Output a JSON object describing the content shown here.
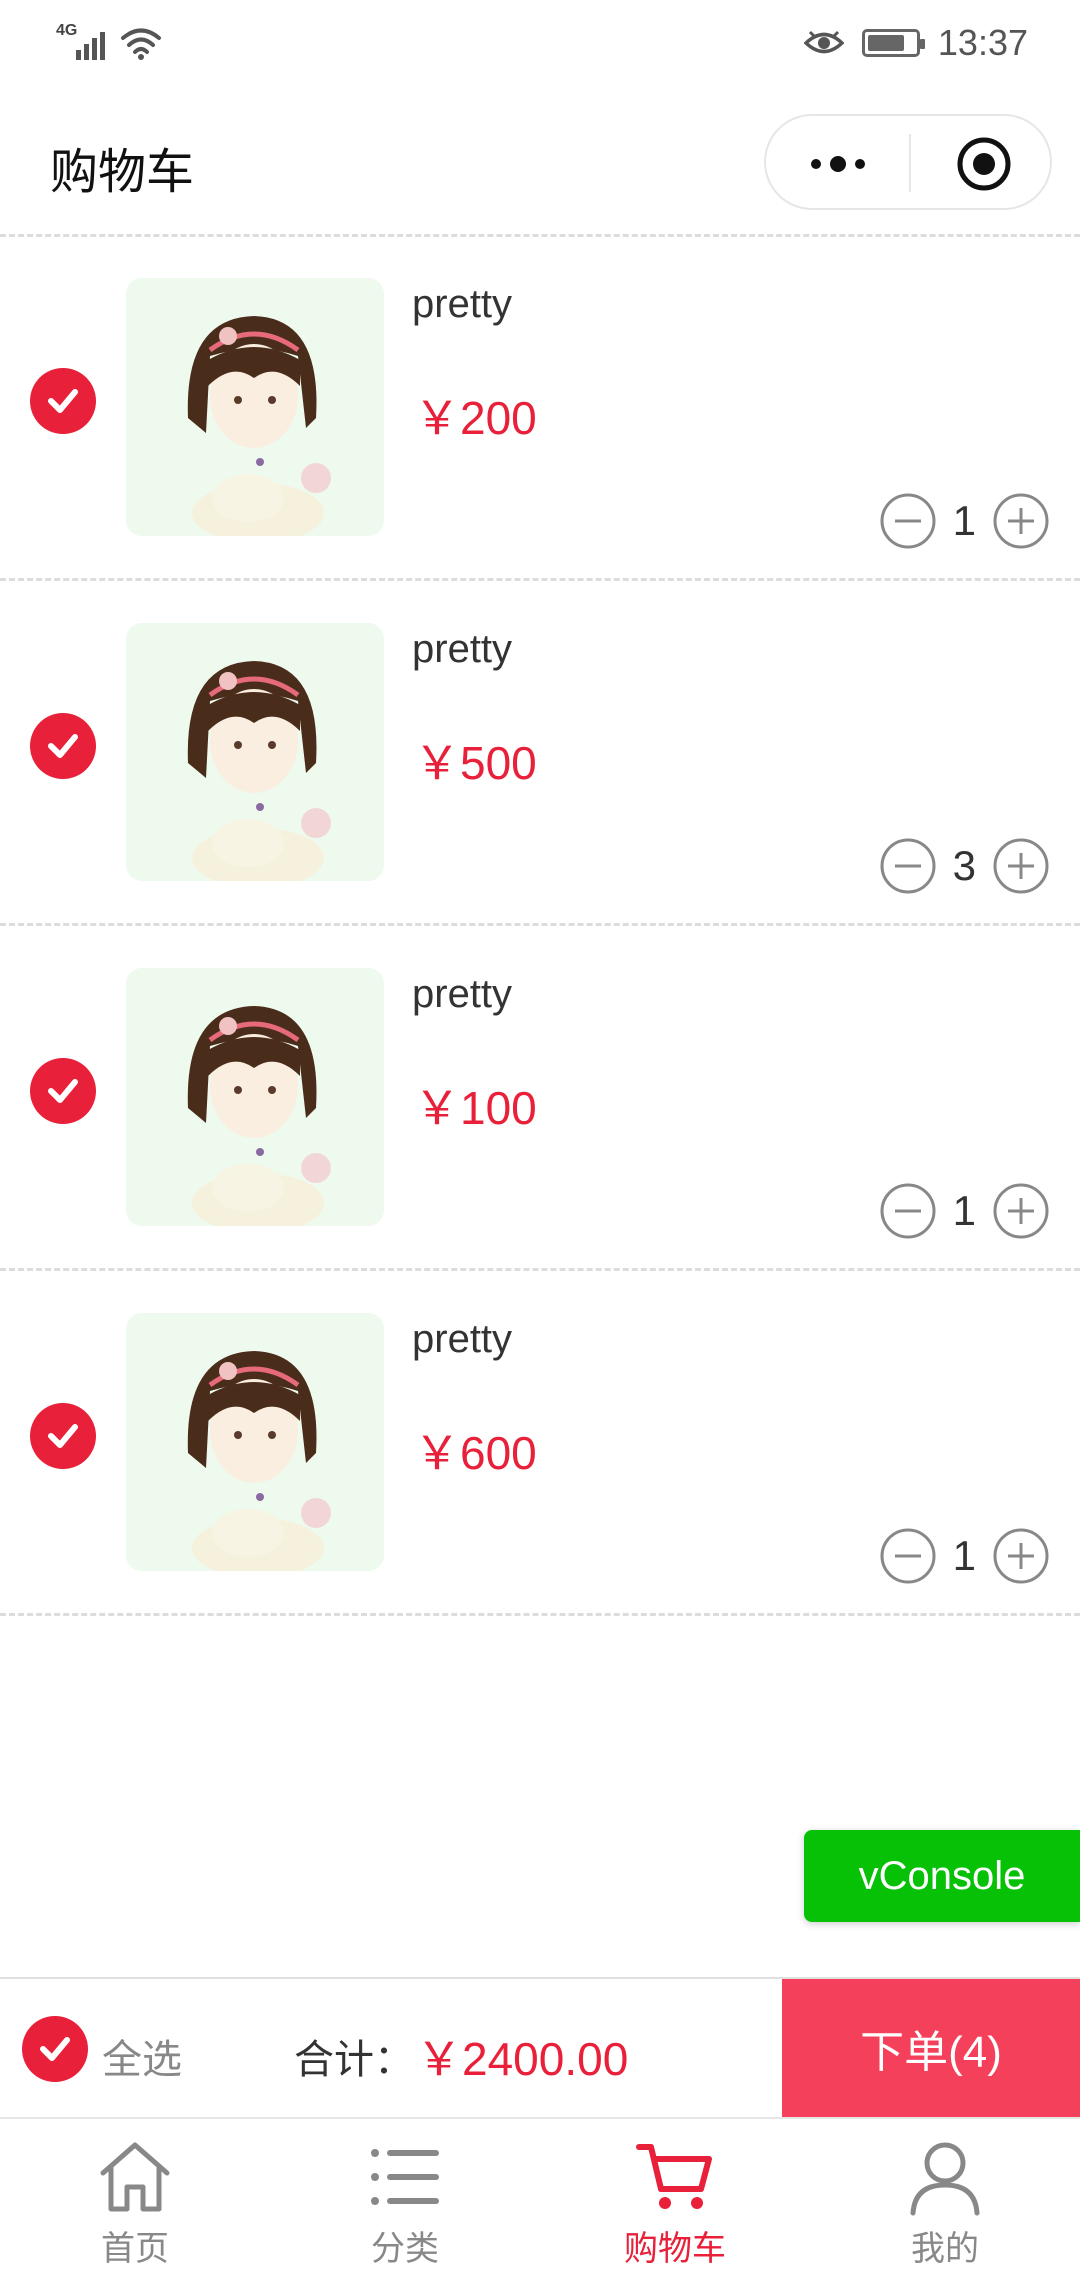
{
  "status_bar": {
    "network": "4G",
    "time": "13:37",
    "battery_level": 0.8
  },
  "nav": {
    "title": "购物车"
  },
  "cart": {
    "items": [
      {
        "name": "pretty",
        "price": "￥200",
        "quantity": "1",
        "checked": true
      },
      {
        "name": "pretty",
        "price": "￥500",
        "quantity": "3",
        "checked": true
      },
      {
        "name": "pretty",
        "price": "￥100",
        "quantity": "1",
        "checked": true
      },
      {
        "name": "pretty",
        "price": "￥600",
        "quantity": "1",
        "checked": true
      }
    ]
  },
  "vconsole": {
    "label": "vConsole"
  },
  "footer": {
    "select_all_label": "全选",
    "total_label": "合计：",
    "total_value": "￥2400.00",
    "order_button_label": "下单(4)"
  },
  "tab_bar": {
    "tabs": [
      {
        "label": "首页",
        "icon": "home-icon",
        "active": false
      },
      {
        "label": "分类",
        "icon": "list-icon",
        "active": false
      },
      {
        "label": "购物车",
        "icon": "cart-icon",
        "active": true
      },
      {
        "label": "我的",
        "icon": "user-icon",
        "active": false
      }
    ]
  },
  "colors": {
    "accent": "#e8203a",
    "order_button": "#f4405a",
    "vconsole": "#07c107"
  }
}
